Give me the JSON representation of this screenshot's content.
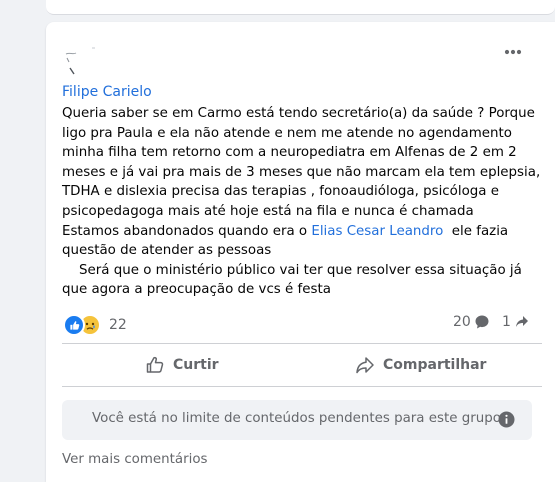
{
  "post": {
    "author": "Filipe Carielo",
    "text_lines": [
      "Queria saber se em Carmo está tendo secretário(a) da saúde ? Porque",
      "ligo pra Paula e ela não atende e nem me atende no agendamento",
      "minha filha tem retorno com a neuropediatra em Alfenas de 2 em 2",
      "meses e já vai pra mais de 3 meses que não marcam ela tem eplepsia,",
      "TDHA e dislexia precisa das terapias , fonoaudióloga, psicóloga e",
      "psicopedagoga mais até hoje está na fila e nunca é chamada"
    ],
    "line7_before": "Estamos abandonados quando era o ",
    "mention": "Elias Cesar Leandro",
    "line7_after": "  ele fazia",
    "text_lines_end": [
      "questão de atender as pessoas",
      "    Será que o ministério público vai ter que resolver essa situação já",
      "que agora a preocupação de vcs é festa"
    ]
  },
  "reactions": {
    "count": "22",
    "types": [
      "like-icon",
      "sad-icon"
    ],
    "like_color": "#1a7cf0",
    "sad_color": "#f5c33b"
  },
  "comments": {
    "count": "20"
  },
  "shares": {
    "count": "1"
  },
  "actions": {
    "like_label": "Curtir",
    "share_label": "Compartilhar"
  },
  "notice": {
    "text": "Você está no limite de conteúdos pendentes para este grupo."
  },
  "more_comments": {
    "label": "Ver mais comentários"
  },
  "colors": {
    "link": "#216fdb",
    "muted": "#65676b",
    "background": "#f0f2f5"
  }
}
